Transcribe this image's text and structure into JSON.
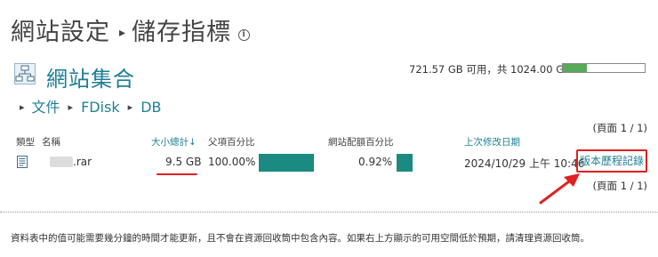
{
  "header": {
    "title_part1": "網站設定",
    "title_part2": "儲存指標"
  },
  "site": {
    "title": "網站集合"
  },
  "storage": {
    "text": "721.57 GB 可用，共 1024.00 GB",
    "used_fraction": 0.295,
    "bar_color": "#58a95a"
  },
  "breadcrumb": [
    "文件",
    "FDisk",
    "DB"
  ],
  "pagination": {
    "top": "(頁面 1 / 1)",
    "bottom": "(頁面 1 / 1)"
  },
  "table": {
    "headers": {
      "type": "類型",
      "name": "名稱",
      "size": "大小總計↓",
      "parent_pct": "父項百分比",
      "site_quota_pct": "網站配額百分比",
      "modified": "上次修改日期"
    },
    "rows": [
      {
        "icon": "document-icon",
        "name": ".rar",
        "size": "9.5 GB",
        "parent_pct": "100.00%",
        "parent_pct_value": 1.0,
        "site_quota_pct": "0.92%",
        "site_quota_value": 0.0092,
        "modified": "2024/10/29 上午 10:46",
        "action": "版本歷程記錄"
      }
    ]
  },
  "colors": {
    "accent": "#1f7f95",
    "bar_teal": "#1b8a80",
    "annotation": "#e02020"
  },
  "footer": {
    "note": "資料表中的值可能需要幾分鐘的時間才能更新，且不會在資源回收筒中包含內容。如果右上方顯示的可用空間低於預期，請清理資源回收筒。"
  }
}
